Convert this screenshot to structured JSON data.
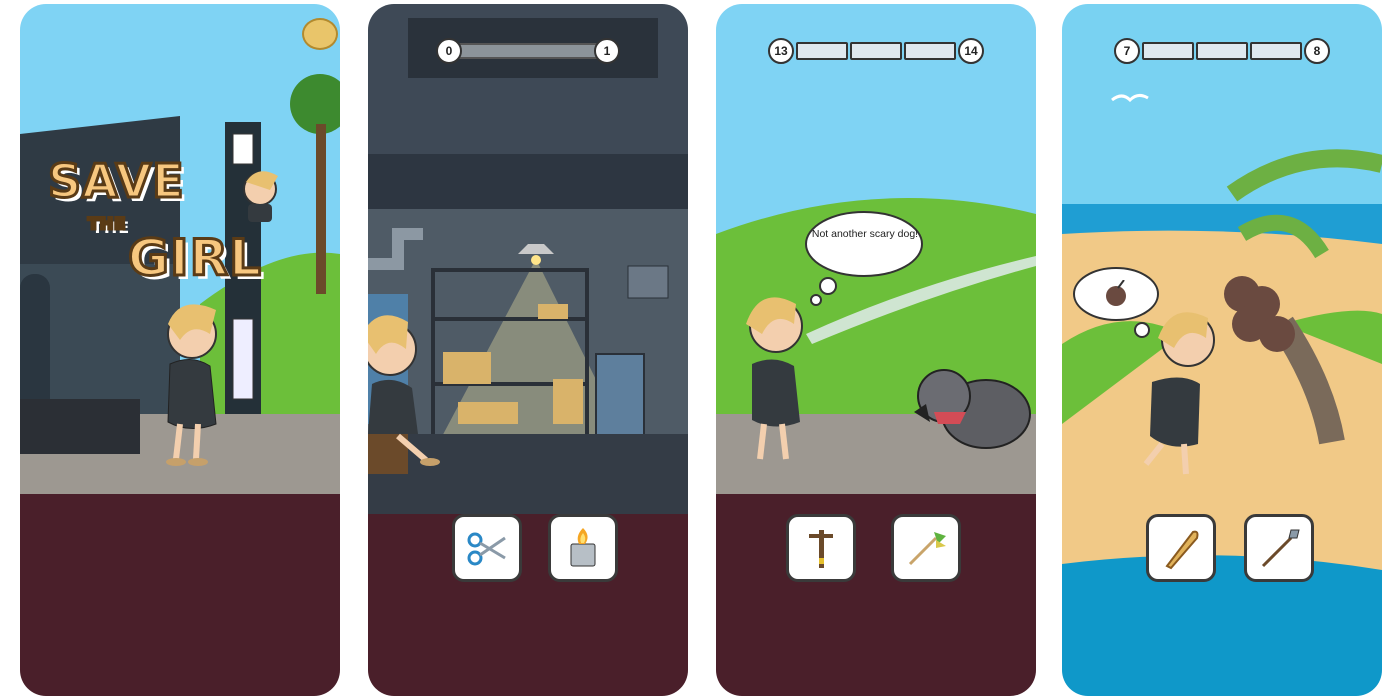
{
  "screens": [
    {
      "id": "title",
      "title": {
        "line1": "SAVE",
        "line2": "THE",
        "line3": "GIRL"
      },
      "colors": {
        "sky": "#7fd3f4",
        "ground": "#4a1f2a"
      }
    },
    {
      "id": "warehouse",
      "level": {
        "from": "0",
        "to": "1"
      },
      "choices": [
        {
          "icon": "scissors-icon"
        },
        {
          "icon": "lighter-icon"
        }
      ],
      "colors": {
        "wall": "#3e4956",
        "ground": "#4a1f2a"
      }
    },
    {
      "id": "dog",
      "level": {
        "from": "13",
        "to": "14"
      },
      "thought": "Not another scary dog!",
      "choices": [
        {
          "icon": "power-pole-icon"
        },
        {
          "icon": "feather-toy-icon"
        }
      ],
      "colors": {
        "sky": "#7fd3f4",
        "ground": "#4a1f2a"
      }
    },
    {
      "id": "beach",
      "level": {
        "from": "7",
        "to": "8"
      },
      "thought_icon": "coconut-drink-icon",
      "choices": [
        {
          "icon": "wooden-club-icon"
        },
        {
          "icon": "spear-icon"
        }
      ],
      "colors": {
        "sky": "#79d2f2",
        "sand": "#f1c987",
        "sea": "#0f98c9"
      }
    }
  ]
}
